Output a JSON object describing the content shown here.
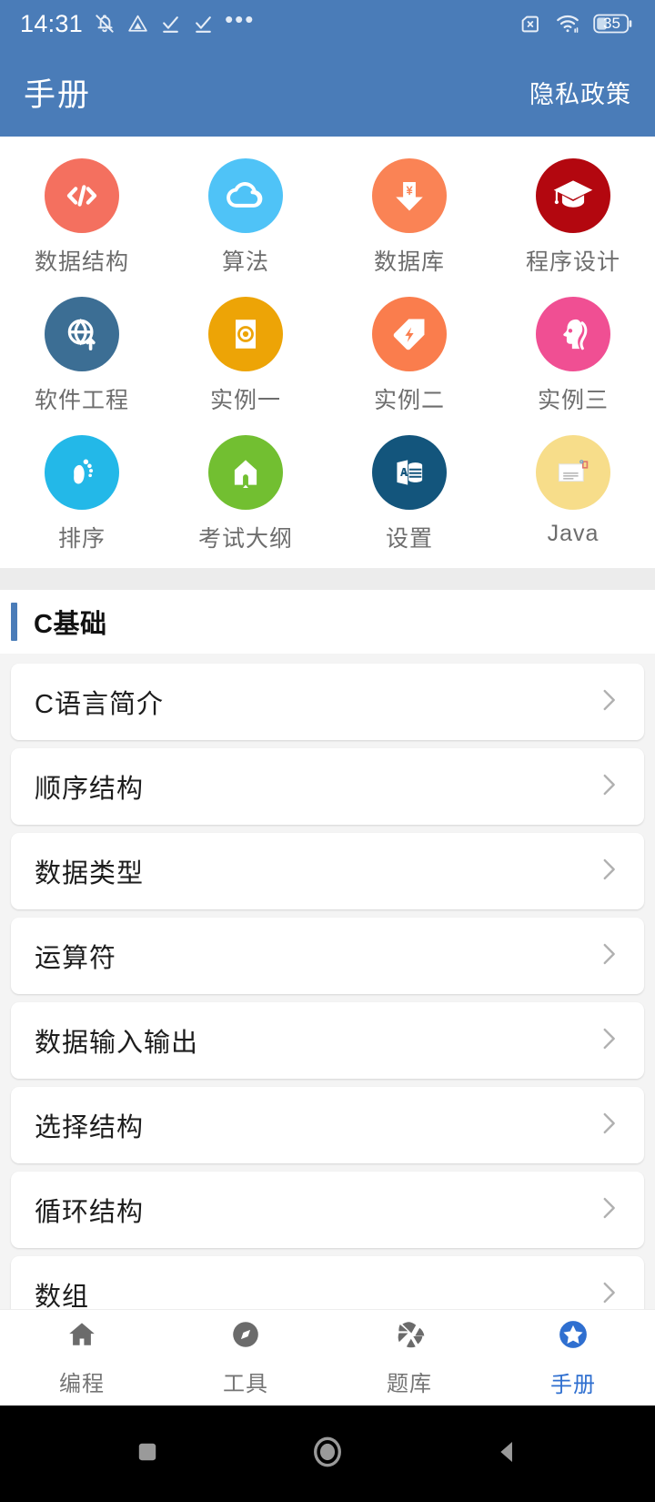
{
  "status_bar": {
    "time": "14:31",
    "left_icons": [
      "bell-muted-icon",
      "drive-triangle-icon",
      "check-underline-icon",
      "check-underline-icon",
      "more-dots-icon"
    ],
    "right_icons": [
      "sim-card-off-icon",
      "wifi-icon",
      "battery-icon"
    ],
    "battery_level": "35"
  },
  "app_bar": {
    "title": "手册",
    "action_label": "隐私政策"
  },
  "grid": {
    "items": [
      {
        "label": "数据结构",
        "icon": "code-brackets-icon",
        "color": "#f4705f",
        "fg": "#ffffff"
      },
      {
        "label": "算法",
        "icon": "cloud-icon",
        "color": "#4fc3f7",
        "fg": "#ffffff"
      },
      {
        "label": "数据库",
        "icon": "download-yen-icon",
        "color": "#fa8355",
        "fg": "#ffffff"
      },
      {
        "label": "程序设计",
        "icon": "graduation-cap-icon",
        "color": "#b3070f",
        "fg": "#ffffff"
      },
      {
        "label": "软件工程",
        "icon": "globe-upload-icon",
        "color": "#3c6e94",
        "fg": "#ffffff"
      },
      {
        "label": "实例一",
        "icon": "disc-document-icon",
        "color": "#eda406",
        "fg": "#ffffff"
      },
      {
        "label": "实例二",
        "icon": "tag-bolt-icon",
        "color": "#fa7d4d",
        "fg": "#ffffff"
      },
      {
        "label": "实例三",
        "icon": "woman-profile-icon",
        "color": "#f04f93",
        "fg": "#ffffff"
      },
      {
        "label": "排序",
        "icon": "footprint-icon",
        "color": "#23b8e8",
        "fg": "#ffffff"
      },
      {
        "label": "考试大纲",
        "icon": "home-arrow-icon",
        "color": "#72bf31",
        "fg": "#ffffff"
      },
      {
        "label": "设置",
        "icon": "access-database-icon",
        "color": "#13557c",
        "fg": "#ffffff"
      },
      {
        "label": "Java",
        "icon": "document-page-icon",
        "color": "#f7dd8a",
        "fg": "#ffffff"
      }
    ]
  },
  "section": {
    "title": "C基础",
    "accent_color": "#4a7cb8"
  },
  "list": {
    "items": [
      {
        "label": "C语言简介"
      },
      {
        "label": "顺序结构"
      },
      {
        "label": "数据类型"
      },
      {
        "label": "运算符"
      },
      {
        "label": "数据输入输出"
      },
      {
        "label": "选择结构"
      },
      {
        "label": "循环结构"
      },
      {
        "label": "数组"
      }
    ]
  },
  "tab_bar": {
    "active_color": "#2f6fd0",
    "inactive_color": "#757575",
    "items": [
      {
        "label": "编程",
        "icon": "home-icon",
        "active": false
      },
      {
        "label": "工具",
        "icon": "compass-icon",
        "active": false
      },
      {
        "label": "题库",
        "icon": "aperture-icon",
        "active": false
      },
      {
        "label": "手册",
        "icon": "star-badge-icon",
        "active": true
      }
    ]
  },
  "android_nav": {
    "buttons": [
      "recents-square-icon",
      "home-circle-icon",
      "back-triangle-icon"
    ]
  }
}
